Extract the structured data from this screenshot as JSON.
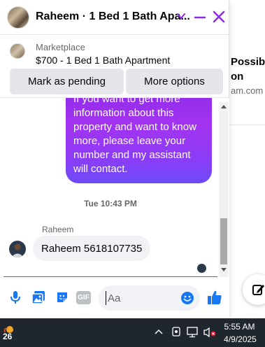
{
  "background": {
    "snippet_line1": "Possibl",
    "snippet_line2": "on",
    "snippet_domain": "am.com"
  },
  "chat": {
    "title": "Raheem · 1 Bed 1 Bath Apa...",
    "listing": {
      "source": "Marketplace",
      "price_title": "$700 - 1 Bed 1 Bath Apartment",
      "mark_pending_label": "Mark as pending",
      "more_options_label": "More options"
    },
    "messages": {
      "outgoing_text": "If you want to get more information about this property and want to know more, please leave your number and my assistant will contact.",
      "timestamp": "Tue 10:43 PM",
      "incoming_sender": "Raheem",
      "incoming_text": "Raheem 5618107735"
    },
    "composer": {
      "placeholder": "Aa",
      "gif_label": "GIF"
    },
    "colors": {
      "accent": "#8b2be8",
      "brand_blue": "#1877f2",
      "bubble_in": "#f0f2f5",
      "button_bg": "#e4e6eb"
    }
  },
  "taskbar": {
    "temperature": "26",
    "time": "5:55 AM",
    "date": "4/9/2025"
  }
}
